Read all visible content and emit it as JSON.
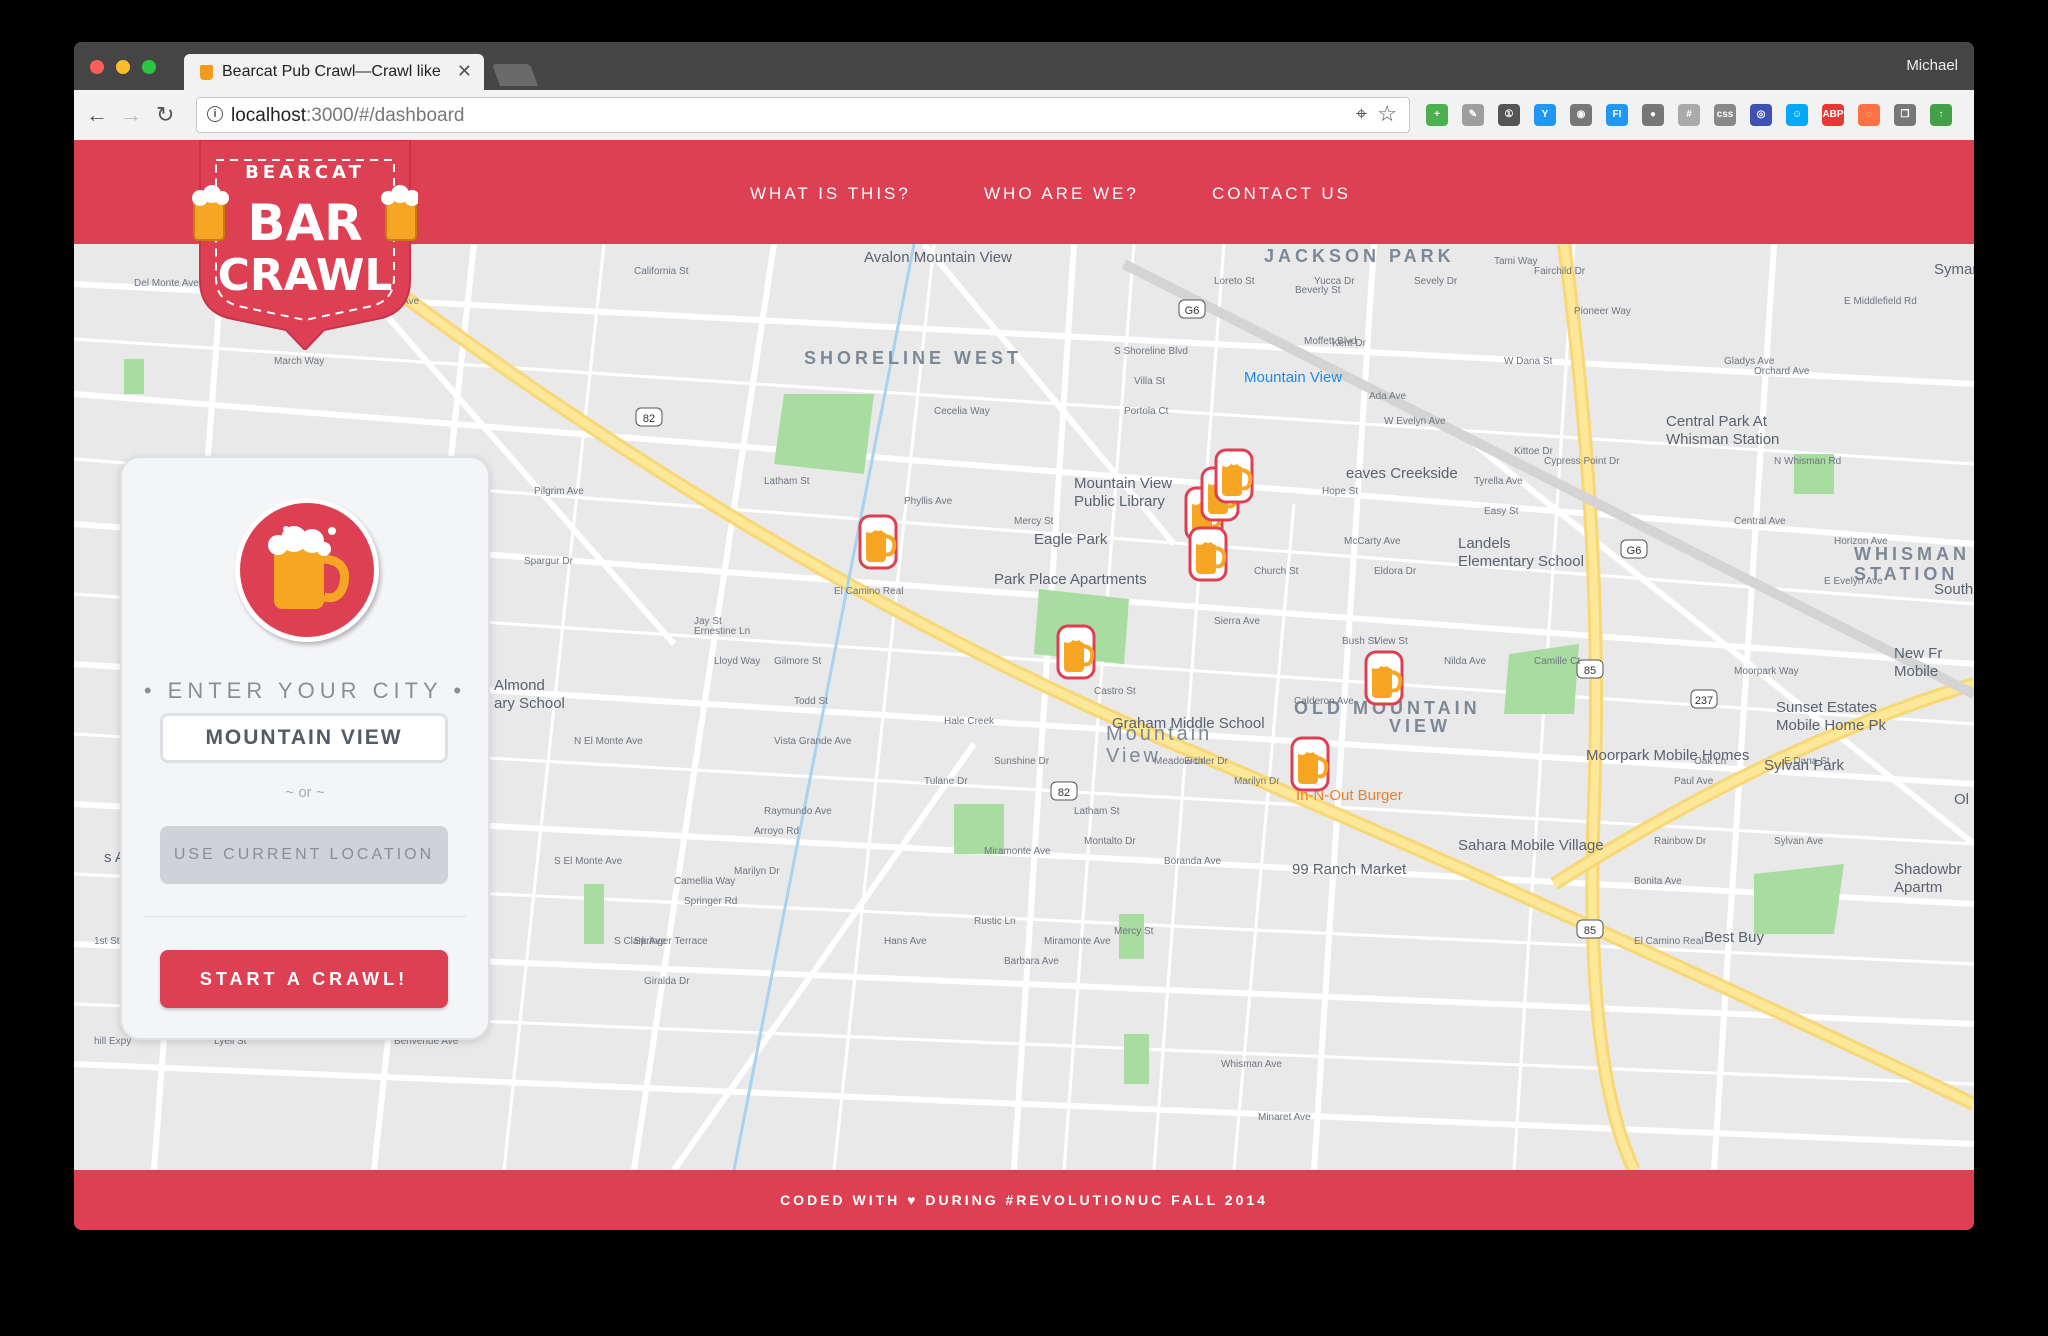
{
  "browser": {
    "tab_title": "Bearcat Pub Crawl—Crawl like",
    "tab_close": "✕",
    "user": "Michael",
    "url_host": "localhost",
    "url_path": ":3000/#/dashboard",
    "back": "←",
    "forward": "→",
    "reload": "↻",
    "extensions": [
      {
        "icon": "plus-ext-icon",
        "label": "+",
        "color": "#4caf50"
      },
      {
        "icon": "pen-ext-icon",
        "label": "✎",
        "color": "#9e9e9e"
      },
      {
        "icon": "onepassword-ext-icon",
        "label": "①",
        "color": "#555555"
      },
      {
        "icon": "vue-ext-icon",
        "label": "Y",
        "color": "#2196f3"
      },
      {
        "icon": "camera-ext-icon",
        "label": "◉",
        "color": "#777777"
      },
      {
        "icon": "fi-ext-icon",
        "label": "FI",
        "color": "#2196f3"
      },
      {
        "icon": "bulb-ext-icon",
        "label": "●",
        "color": "#777777"
      },
      {
        "icon": "hash-ext-icon",
        "label": "#",
        "color": "#aaaaaa"
      },
      {
        "icon": "css-ext-icon",
        "label": "css",
        "color": "#888888"
      },
      {
        "icon": "globe-ext-icon",
        "label": "◎",
        "color": "#3f51b5"
      },
      {
        "icon": "robot-ext-icon",
        "label": "☺",
        "color": "#03a9f4"
      },
      {
        "icon": "abp-ext-icon",
        "label": "ABP",
        "color": "#e53935"
      },
      {
        "icon": "ring-ext-icon",
        "label": "◌",
        "color": "#ff7043"
      },
      {
        "icon": "windows-ext-icon",
        "label": "❐",
        "color": "#777777"
      },
      {
        "icon": "up-arrow-ext-icon",
        "label": "↑",
        "color": "#43a047"
      }
    ]
  },
  "header": {
    "logo_top": "BEARCAT",
    "logo_mid": "BAR",
    "logo_bottom": "CRAWL",
    "nav": [
      "WHAT IS THIS?",
      "WHO ARE WE?",
      "CONTACT US"
    ]
  },
  "panel": {
    "enter_label": "• ENTER YOUR CITY •",
    "city_value": "MOUNTAIN VIEW",
    "or_label": "~ or ~",
    "location_button": "USE CURRENT LOCATION",
    "start_button": "START A CRAWL!"
  },
  "footer": {
    "text_before": "CODED WITH",
    "heart": "♥",
    "text_after": "DURING #REVOLUTIONUC FALL 2014"
  },
  "map": {
    "labels": [
      "JACKSON PARK",
      "SHORELINE WEST",
      "OLD MOUNTAIN",
      "VIEW",
      "Mountain",
      "View",
      "WHISMAN",
      "STATION",
      "Avalon Mountain View",
      "Mountain View",
      "Central Park At",
      "Whisman Station",
      "Mountain View",
      "Public Library",
      "Eagle Park",
      "Park Place Apartments",
      "eaves Creekside",
      "Landels",
      "Elementary School",
      "Graham Middle School",
      "In-N-Out Burger",
      "Moorpark Mobile Homes",
      "Sunset Estates",
      "Mobile Home Pk",
      "Sylvan Park",
      "Sahara Mobile Village",
      "99 Ranch Market",
      "Best Buy",
      "Almond",
      "ary School",
      "s Altos Grill",
      "Del Monte Ave",
      "California St",
      "E Middlefield Rd",
      "Gladys Ave",
      "W Evelyn Ave",
      "E Evelyn Ave",
      "El Camino Real",
      "El Camino Real",
      "Moffett Blvd",
      "S Shoreline Blvd",
      "Castro St",
      "Calderon Ave",
      "Miramonte Ave",
      "Springer Rd",
      "S El Monte Ave",
      "N El Monte Ave",
      "Hale Creek",
      "S Clark Ave",
      "N Whisman Rd",
      "E Dana St",
      "Moorpark Way",
      "Latham St",
      "Church St",
      "Sierra Ave",
      "Villa St",
      "Mercy St",
      "Hope St",
      "Bush St",
      "View St",
      "Phyllis Ave",
      "Rengstorff Ave",
      "New Fr",
      "Mobile",
      "Shadowbr",
      "Apartm",
      "Sylvan Ave",
      "Symantec",
      "Southb",
      "Ol",
      "1st St",
      "S San Ant",
      "hill Expy",
      "Lyell St",
      "Marvin Ave",
      "Pepper Dr",
      "Hawthorne Ave",
      "Benvenue Ave",
      "Giralda Dr",
      "Springer Terrace",
      "Camellia Way",
      "Marilyn Dr",
      "Arroyo Rd",
      "Raymundo Ave",
      "Vista Grande Ave",
      "Gilmore St",
      "Todd St",
      "Ernestine Ln",
      "Lloyd Way",
      "Jay St",
      "Spargur Dr",
      "Pilgrim Ave",
      "Edmanry Way",
      "March Way",
      "Cecelia Way",
      "Portola Ct",
      "Latham St",
      "Mercy St",
      "Miramonte Ave",
      "Montalto Dr",
      "Barbara Ave",
      "Hans Ave",
      "Rustic Ln",
      "Tulane Dr",
      "Sunshine Dr",
      "Meadow Ln",
      "Eichler Dr",
      "Marilyn Dr",
      "Boranda Ave",
      "Bonita Ave",
      "Nilda Ave",
      "Camille Ct",
      "Oak Ln",
      "Rainbow Dr",
      "Paul Ave",
      "Eldora Dr",
      "McCarty Ave",
      "Pioneer Way",
      "Fairchild Dr",
      "Tami Way",
      "Sevely Dr",
      "Yucca Dr",
      "Loreto St",
      "W Dana St",
      "Kittoe Dr",
      "Tyrella Ave",
      "Easy St",
      "Cypress Point Dr",
      "Central Ave",
      "Horizon Ave",
      "Orchard Ave",
      "Whisman Ave",
      "Minaret Ave",
      "Beverly St",
      "Kent Dr",
      "Ada Ave"
    ],
    "highways": [
      "82",
      "82",
      "85",
      "85",
      "237",
      "G6",
      "G6"
    ]
  }
}
